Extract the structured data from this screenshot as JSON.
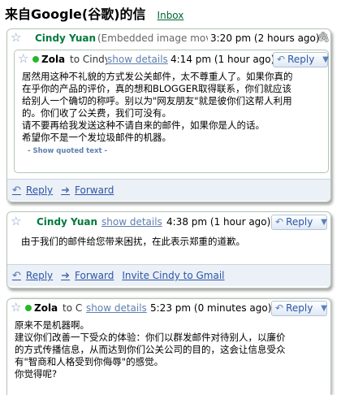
{
  "header": {
    "title": "来自Google(谷歌)的信",
    "inbox_label": "Inbox"
  },
  "thread": {
    "msg1": {
      "sender": "Cindy Yuan",
      "preview": "(Embedded image mov",
      "time": "3:20 pm (2 hours ago)",
      "quoted": {
        "sender": "Zola",
        "to_preview": "to Cindy",
        "show_details": "show details",
        "time": "4:14 pm (1 hour ago)",
        "reply_label": "Reply",
        "body": [
          "居然用这种不礼貌的方式发公关邮件，太不尊重人了。如果你真的",
          "在乎你的产品的评价，真的想和BLOGGER取得联系，你们就应该",
          "给别人一个确切的称呼。别以为\"网友朋友\"就是彼你们这帮人利用",
          "的。你们收了公关费，我们可没有。",
          "请不要再给我发送这种不请自来的邮件，如果你是人的话。",
          "希望你不是一个发垃圾邮件的机器。"
        ],
        "show_quoted": "- Show quoted text -"
      },
      "actions": {
        "reply": "Reply",
        "forward": "Forward"
      }
    },
    "msg2": {
      "sender": "Cindy Yuan",
      "show_details": "show details",
      "time": "4:38 pm (1 hour ago)",
      "reply_label": "Reply",
      "body": [
        "由于我们的邮件给您带来困扰，在此表示郑重的道歉。"
      ],
      "actions": {
        "reply": "Reply",
        "forward": "Forward",
        "invite": "Invite Cindy to Gmail"
      }
    },
    "msg3": {
      "sender": "Zola",
      "to_preview": "to C",
      "show_details": "show details",
      "time": "5:23 pm (0 minutes ago)",
      "reply_label": "Reply",
      "body": [
        "原来不是机器啊。",
        "建议你们改善一下受众的体验：你们以群发邮件对待别人，以廉价",
        "的方式传播信息，从而达到你们公关公司的目的，这会让信息受众",
        "有\"智商和人格受到你侮辱\"的感觉。",
        "你觉得呢?"
      ]
    }
  },
  "colors": {
    "sender_green": "#007a3d",
    "link_blue": "#2a57a8",
    "online_dot": "#2bb52b",
    "action_bar": "#ecf0f7"
  },
  "icons": {
    "star": "star-icon",
    "reply": "reply-icon",
    "forward": "forward-icon",
    "dropdown": "chevron-down-icon",
    "attachment": "paperclip-icon"
  }
}
